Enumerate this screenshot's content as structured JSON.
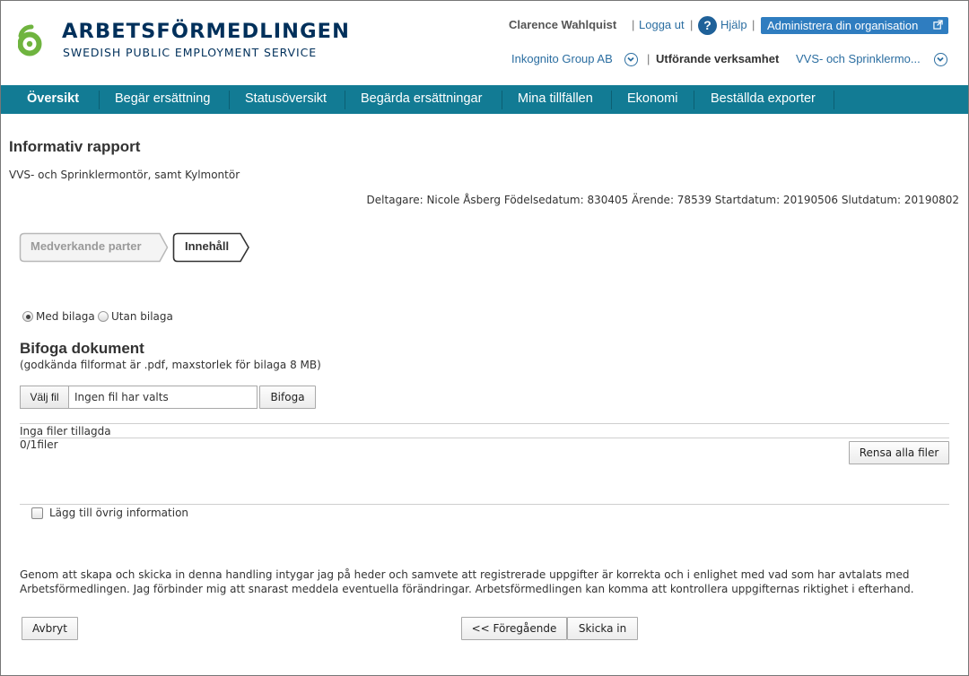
{
  "header": {
    "logo_title": "ARBETSFÖRMEDLINGEN",
    "logo_subtitle": "SWEDISH PUBLIC EMPLOYMENT SERVICE",
    "user_name": "Clarence Wahlquist",
    "logout": "Logga ut",
    "help_icon_glyph": "?",
    "help": "Hjälp",
    "admin_button": "Administrera din organisation",
    "organisation": "Inkognito Group AB",
    "verksamhet_label": "Utförande verksamhet",
    "verksamhet_value": "VVS- och Sprinklermo...",
    "separator": "|",
    "logo_color": "#6fb43f",
    "brand_color": "#00305b"
  },
  "nav": {
    "color": "#127b94",
    "items": [
      {
        "label": "Översikt",
        "active": true
      },
      {
        "label": "Begär ersättning"
      },
      {
        "label": "Statusöversikt"
      },
      {
        "label": "Begärda ersättningar"
      },
      {
        "label": "Mina tillfällen"
      },
      {
        "label": "Ekonomi"
      },
      {
        "label": "Beställda exporter"
      }
    ]
  },
  "page": {
    "title": "Informativ rapport",
    "subtitle": "VVS- och Sprinklermontör, samt Kylmontör",
    "participant_line": "Deltagare: Nicole Åsberg Födelsedatum: 830405 Ärende: 78539 Startdatum: 20190506 Slutdatum: 20190802"
  },
  "steps": [
    {
      "label": "Medverkande parter",
      "active": false
    },
    {
      "label": "Innehåll",
      "active": true
    }
  ],
  "attachment_options": {
    "with": "Med bilaga",
    "without": "Utan bilaga",
    "selected": "with"
  },
  "upload": {
    "title": "Bifoga dokument",
    "hint": "(godkända filformat är .pdf, maxstorlek för bilaga 8 MB)",
    "choose_file": "Välj fil",
    "no_file": "Ingen fil har valts",
    "attach_button": "Bifoga",
    "no_files": "Inga filer tillagda",
    "file_count": "0/1filer",
    "clear_button": "Rensa alla filer"
  },
  "extra_info": {
    "label": "Lägg till övrig information",
    "checked": false
  },
  "legal_text": "Genom att skapa och skicka in denna handling intygar jag på heder och samvete att registrerade uppgifter är korrekta och i enlighet med vad som har avtalats med Arbetsförmedlingen. Jag förbinder mig att snarast meddela eventuella förändringar. Arbetsförmedlingen kan komma att kontrollera uppgifternas riktighet i efterhand.",
  "actions": {
    "cancel": "Avbryt",
    "previous": "<< Föregående",
    "submit": "Skicka in"
  }
}
